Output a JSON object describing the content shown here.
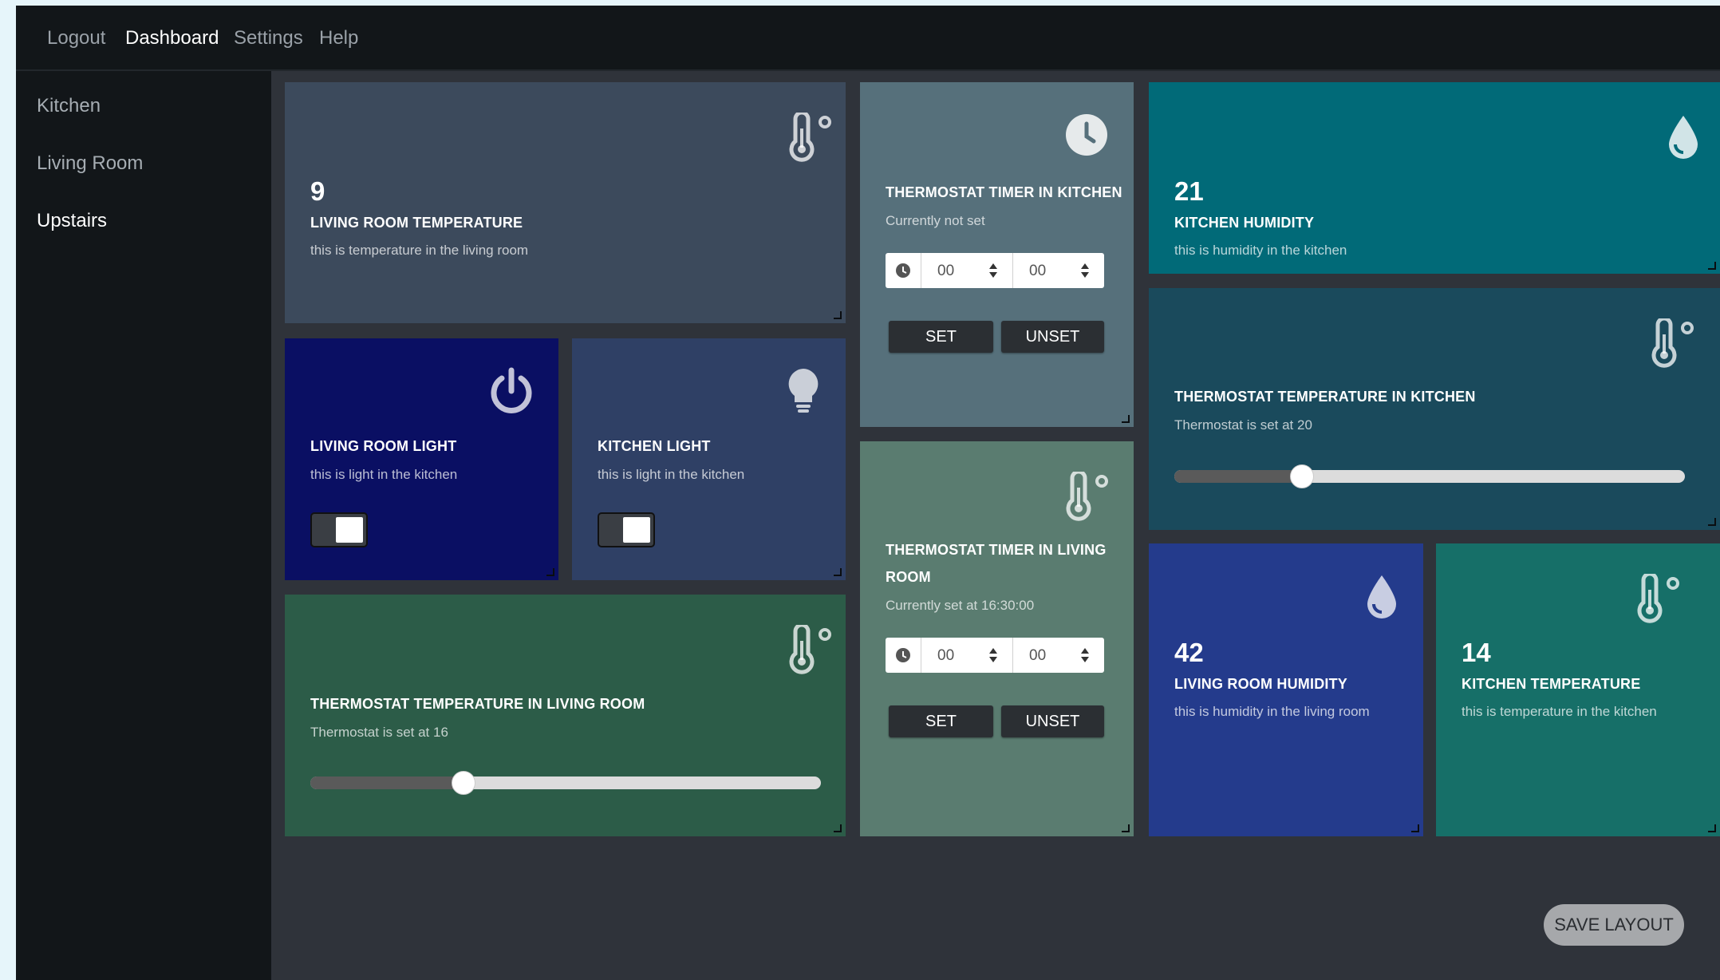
{
  "nav": {
    "logout": "Logout",
    "dashboard": "Dashboard",
    "settings": "Settings",
    "help": "Help"
  },
  "sidebar": {
    "items": [
      {
        "label": "Kitchen"
      },
      {
        "label": "Living Room"
      },
      {
        "label": "Upstairs"
      }
    ]
  },
  "cards": {
    "living_room_temperature": {
      "value": "9",
      "title": "LIVING ROOM TEMPERATURE",
      "desc": "this is temperature in the living room",
      "color": "#3c4a5c",
      "icon": "thermometer-icon"
    },
    "thermostat_timer_kitchen": {
      "title": "THERMOSTAT TIMER IN KITCHEN",
      "desc": "Currently not set",
      "hours": "00",
      "minutes": "00",
      "set_label": "SET",
      "unset_label": "UNSET",
      "color": "#56707b",
      "icon": "clock-icon"
    },
    "kitchen_humidity": {
      "value": "21",
      "title": "KITCHEN HUMIDITY",
      "desc": "this is humidity in the kitchen",
      "color": "#016a78",
      "icon": "droplet-icon"
    },
    "living_room_light": {
      "title": "LIVING ROOM LIGHT",
      "desc": "this is light in the kitchen",
      "color": "#0a0f63",
      "icon": "power-icon",
      "on": true
    },
    "kitchen_light": {
      "title": "KITCHEN LIGHT",
      "desc": "this is light in the kitchen",
      "color": "#2f4065",
      "icon": "lightbulb-icon",
      "on": true
    },
    "thermostat_temperature_kitchen": {
      "title": "THERMOSTAT TEMPERATURE IN KITCHEN",
      "desc": "Thermostat is set at 20",
      "level": 0.25,
      "color": "#1a4a5c",
      "icon": "thermometer-icon"
    },
    "thermostat_timer_living_room": {
      "title_line1": "THERMOSTAT TIMER IN LIVING",
      "title_line2": "ROOM",
      "desc": "Currently set at 16:30:00",
      "hours": "00",
      "minutes": "00",
      "set_label": "SET",
      "unset_label": "UNSET",
      "color": "#5a7c70",
      "icon": "thermometer-icon"
    },
    "thermostat_temperature_living_room": {
      "title": "THERMOSTAT TEMPERATURE IN LIVING ROOM",
      "desc": "Thermostat is set at 16",
      "level": 0.3,
      "color": "#2c5c48",
      "icon": "thermometer-icon"
    },
    "living_room_humidity": {
      "value": "42",
      "title": "LIVING ROOM HUMIDITY",
      "desc": "this is humidity in the living room",
      "color": "#243b8c",
      "icon": "droplet-icon"
    },
    "kitchen_temperature": {
      "value": "14",
      "title": "KITCHEN TEMPERATURE",
      "desc": "this is temperature in the kitchen",
      "color": "#166f68",
      "icon": "thermometer-icon"
    }
  },
  "save_layout_label": "SAVE LAYOUT"
}
